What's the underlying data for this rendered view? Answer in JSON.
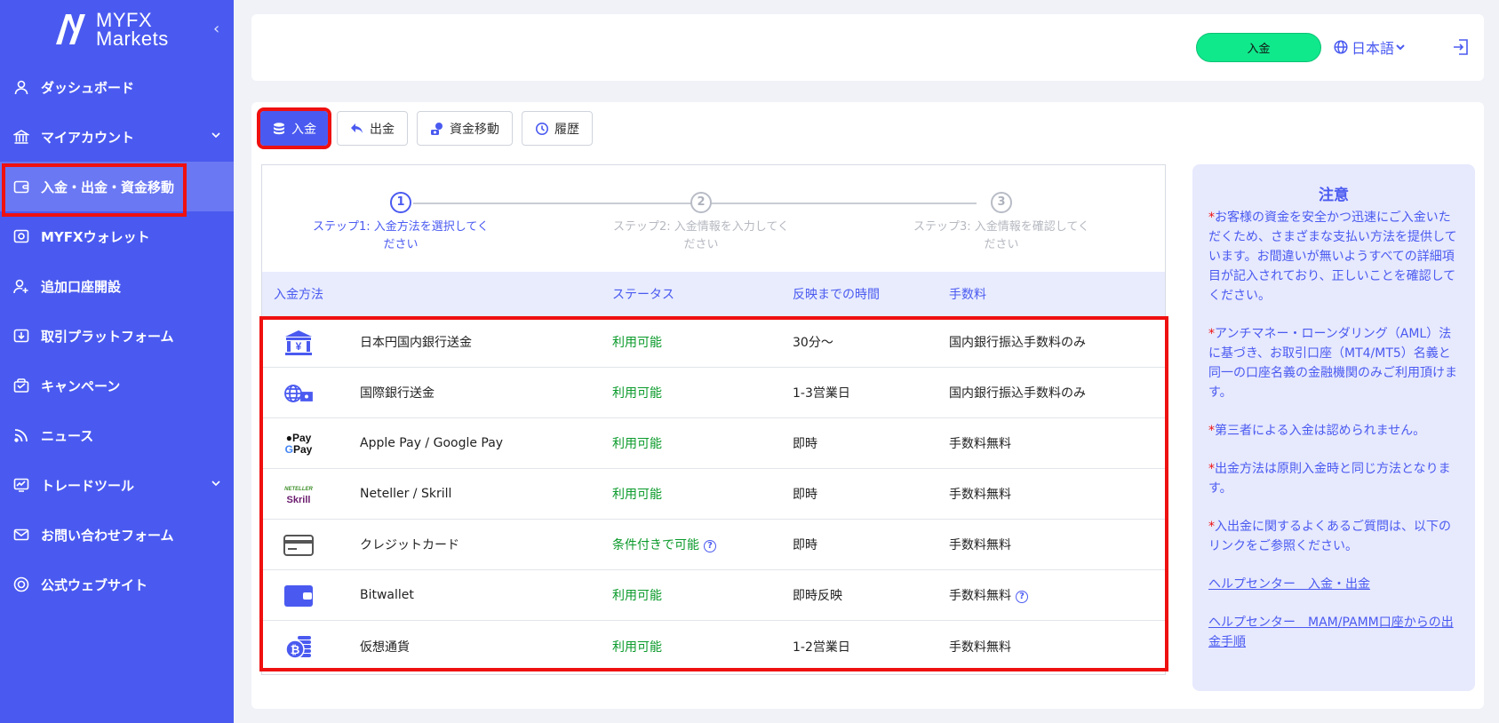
{
  "app": {
    "brand_line1": "MYFX",
    "brand_line2": "Markets"
  },
  "sidebar": {
    "items": [
      {
        "label": "ダッシュボード",
        "icon": "user-icon"
      },
      {
        "label": "マイアカウント",
        "icon": "bank-icon",
        "expandable": true
      },
      {
        "label": "入金・出金・資金移動",
        "icon": "wallet-icon",
        "active": true
      },
      {
        "label": "MYFXウォレット",
        "icon": "safe-icon"
      },
      {
        "label": "追加口座開設",
        "icon": "add-user-icon"
      },
      {
        "label": "取引プラットフォーム",
        "icon": "download-icon"
      },
      {
        "label": "キャンペーン",
        "icon": "gift-icon"
      },
      {
        "label": "ニュース",
        "icon": "rss-icon"
      },
      {
        "label": "トレードツール",
        "icon": "chart-icon",
        "expandable": true
      },
      {
        "label": "お問い合わせフォーム",
        "icon": "mail-icon"
      },
      {
        "label": "公式ウェブサイト",
        "icon": "globe-icon"
      }
    ]
  },
  "header": {
    "deposit_button": "入金",
    "language": "日本語"
  },
  "tabs": [
    {
      "label": "入金",
      "icon": "coins-icon",
      "active": true
    },
    {
      "label": "出金",
      "icon": "undo-icon"
    },
    {
      "label": "資金移動",
      "icon": "transfer-icon"
    },
    {
      "label": "履歴",
      "icon": "history-icon"
    }
  ],
  "steps": [
    {
      "num": "1",
      "label": "ステップ1: 入金方法を選択してください",
      "active": true
    },
    {
      "num": "2",
      "label": "ステップ2: 入金情報を入力してください"
    },
    {
      "num": "3",
      "label": "ステップ3: 入金情報を確認してください"
    }
  ],
  "table": {
    "headers": {
      "method": "入金方法",
      "status": "ステータス",
      "time": "反映までの時間",
      "fee": "手数料"
    },
    "rows": [
      {
        "icon": "yen-bank-icon",
        "name": "日本円国内銀行送金",
        "status": "利用可能",
        "time": "30分～",
        "fee": "国内銀行振込手数料のみ"
      },
      {
        "icon": "international-bank-icon",
        "name": "国際銀行送金",
        "status": "利用可能",
        "time": "1-3営業日",
        "fee": "国内銀行振込手数料のみ"
      },
      {
        "icon": "apple-google-pay-icon",
        "name": "Apple Pay / Google Pay",
        "status": "利用可能",
        "time": "即時",
        "fee": "手数料無料"
      },
      {
        "icon": "neteller-skrill-icon",
        "name": "Neteller / Skrill",
        "status": "利用可能",
        "time": "即時",
        "fee": "手数料無料"
      },
      {
        "icon": "credit-card-icon",
        "name": "クレジットカード",
        "status": "条件付きで可能",
        "status_help": true,
        "time": "即時",
        "fee": "手数料無料"
      },
      {
        "icon": "bitwallet-icon",
        "name": "Bitwallet",
        "status": "利用可能",
        "time": "即時反映",
        "fee": "手数料無料",
        "fee_help": true
      },
      {
        "icon": "crypto-icon",
        "name": "仮想通貨",
        "status": "利用可能",
        "time": "1-2営業日",
        "fee": "手数料無料"
      }
    ],
    "logo_text": {
      "apple_pay": "Pay",
      "google_pay": "Pay",
      "neteller": "NETELLER",
      "skrill": "Skrill"
    }
  },
  "notice": {
    "title": "注意",
    "star": "*",
    "paragraphs": [
      "お客様の資金を安全かつ迅速にご入金いただくため、さまざまな支払い方法を提供しています。お間違いが無いようすべての詳細項目が記入されており、正しいことを確認してください。",
      "アンチマネー・ローンダリング（AML）法に基づき、お取引口座（MT4/MT5）名義と同一の口座名義の金融機関のみご利用頂けます。",
      "第三者による入金は認められません。",
      "出金方法は原則入金時と同じ方法となります。",
      "入出金に関するよくあるご質問は、以下のリンクをご参照ください。"
    ],
    "links": [
      "ヘルプセンター　入金・出金",
      "ヘルプセンター　MAM/PAMM口座からの出金手順"
    ]
  },
  "colors": {
    "primary": "#4a5af0",
    "deposit_green": "#10e88c",
    "status_green": "#0a9a2a",
    "highlight_red": "#ef1010"
  }
}
